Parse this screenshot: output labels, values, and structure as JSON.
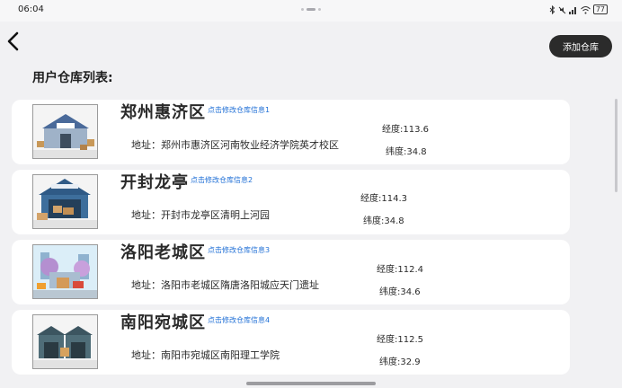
{
  "status_bar": {
    "time": "06:04",
    "icons": [
      "bluetooth-icon",
      "mute-icon",
      "signal-icon",
      "wifi-icon",
      "battery-icon"
    ],
    "battery_level": "77"
  },
  "header": {
    "back_icon": "chevron-left-icon",
    "add_button_label": "添加仓库",
    "title": "用户仓库列表:"
  },
  "warehouses": [
    {
      "name": "郑州惠济区",
      "edit_label": "点击修改仓库信息1",
      "address": "地址：郑州市惠济区河南牧业经济学院英才校区",
      "longitude": "经度:113.6",
      "latitude": "纬度:34.8"
    },
    {
      "name": "开封龙亭",
      "edit_label": "点击修改仓库信息2",
      "address": "地址：开封市龙亭区清明上河园",
      "longitude": "经度:114.3",
      "latitude": "纬度:34.8"
    },
    {
      "name": "洛阳老城区",
      "edit_label": "点击修改仓库信息3",
      "address": "地址：洛阳市老城区隋唐洛阳城应天门遗址",
      "longitude": "经度:112.4",
      "latitude": "纬度:34.6"
    },
    {
      "name": "南阳宛城区",
      "edit_label": "点击修改仓库信息4",
      "address": "地址：南阳市宛城区南阳理工学院",
      "longitude": "经度:112.5",
      "latitude": "纬度:32.9"
    }
  ],
  "colors": {
    "accent_link": "#1f6fd6",
    "button_bg": "#2b2b2b",
    "page_bg": "#f1f1f3",
    "card_bg": "#ffffff"
  }
}
